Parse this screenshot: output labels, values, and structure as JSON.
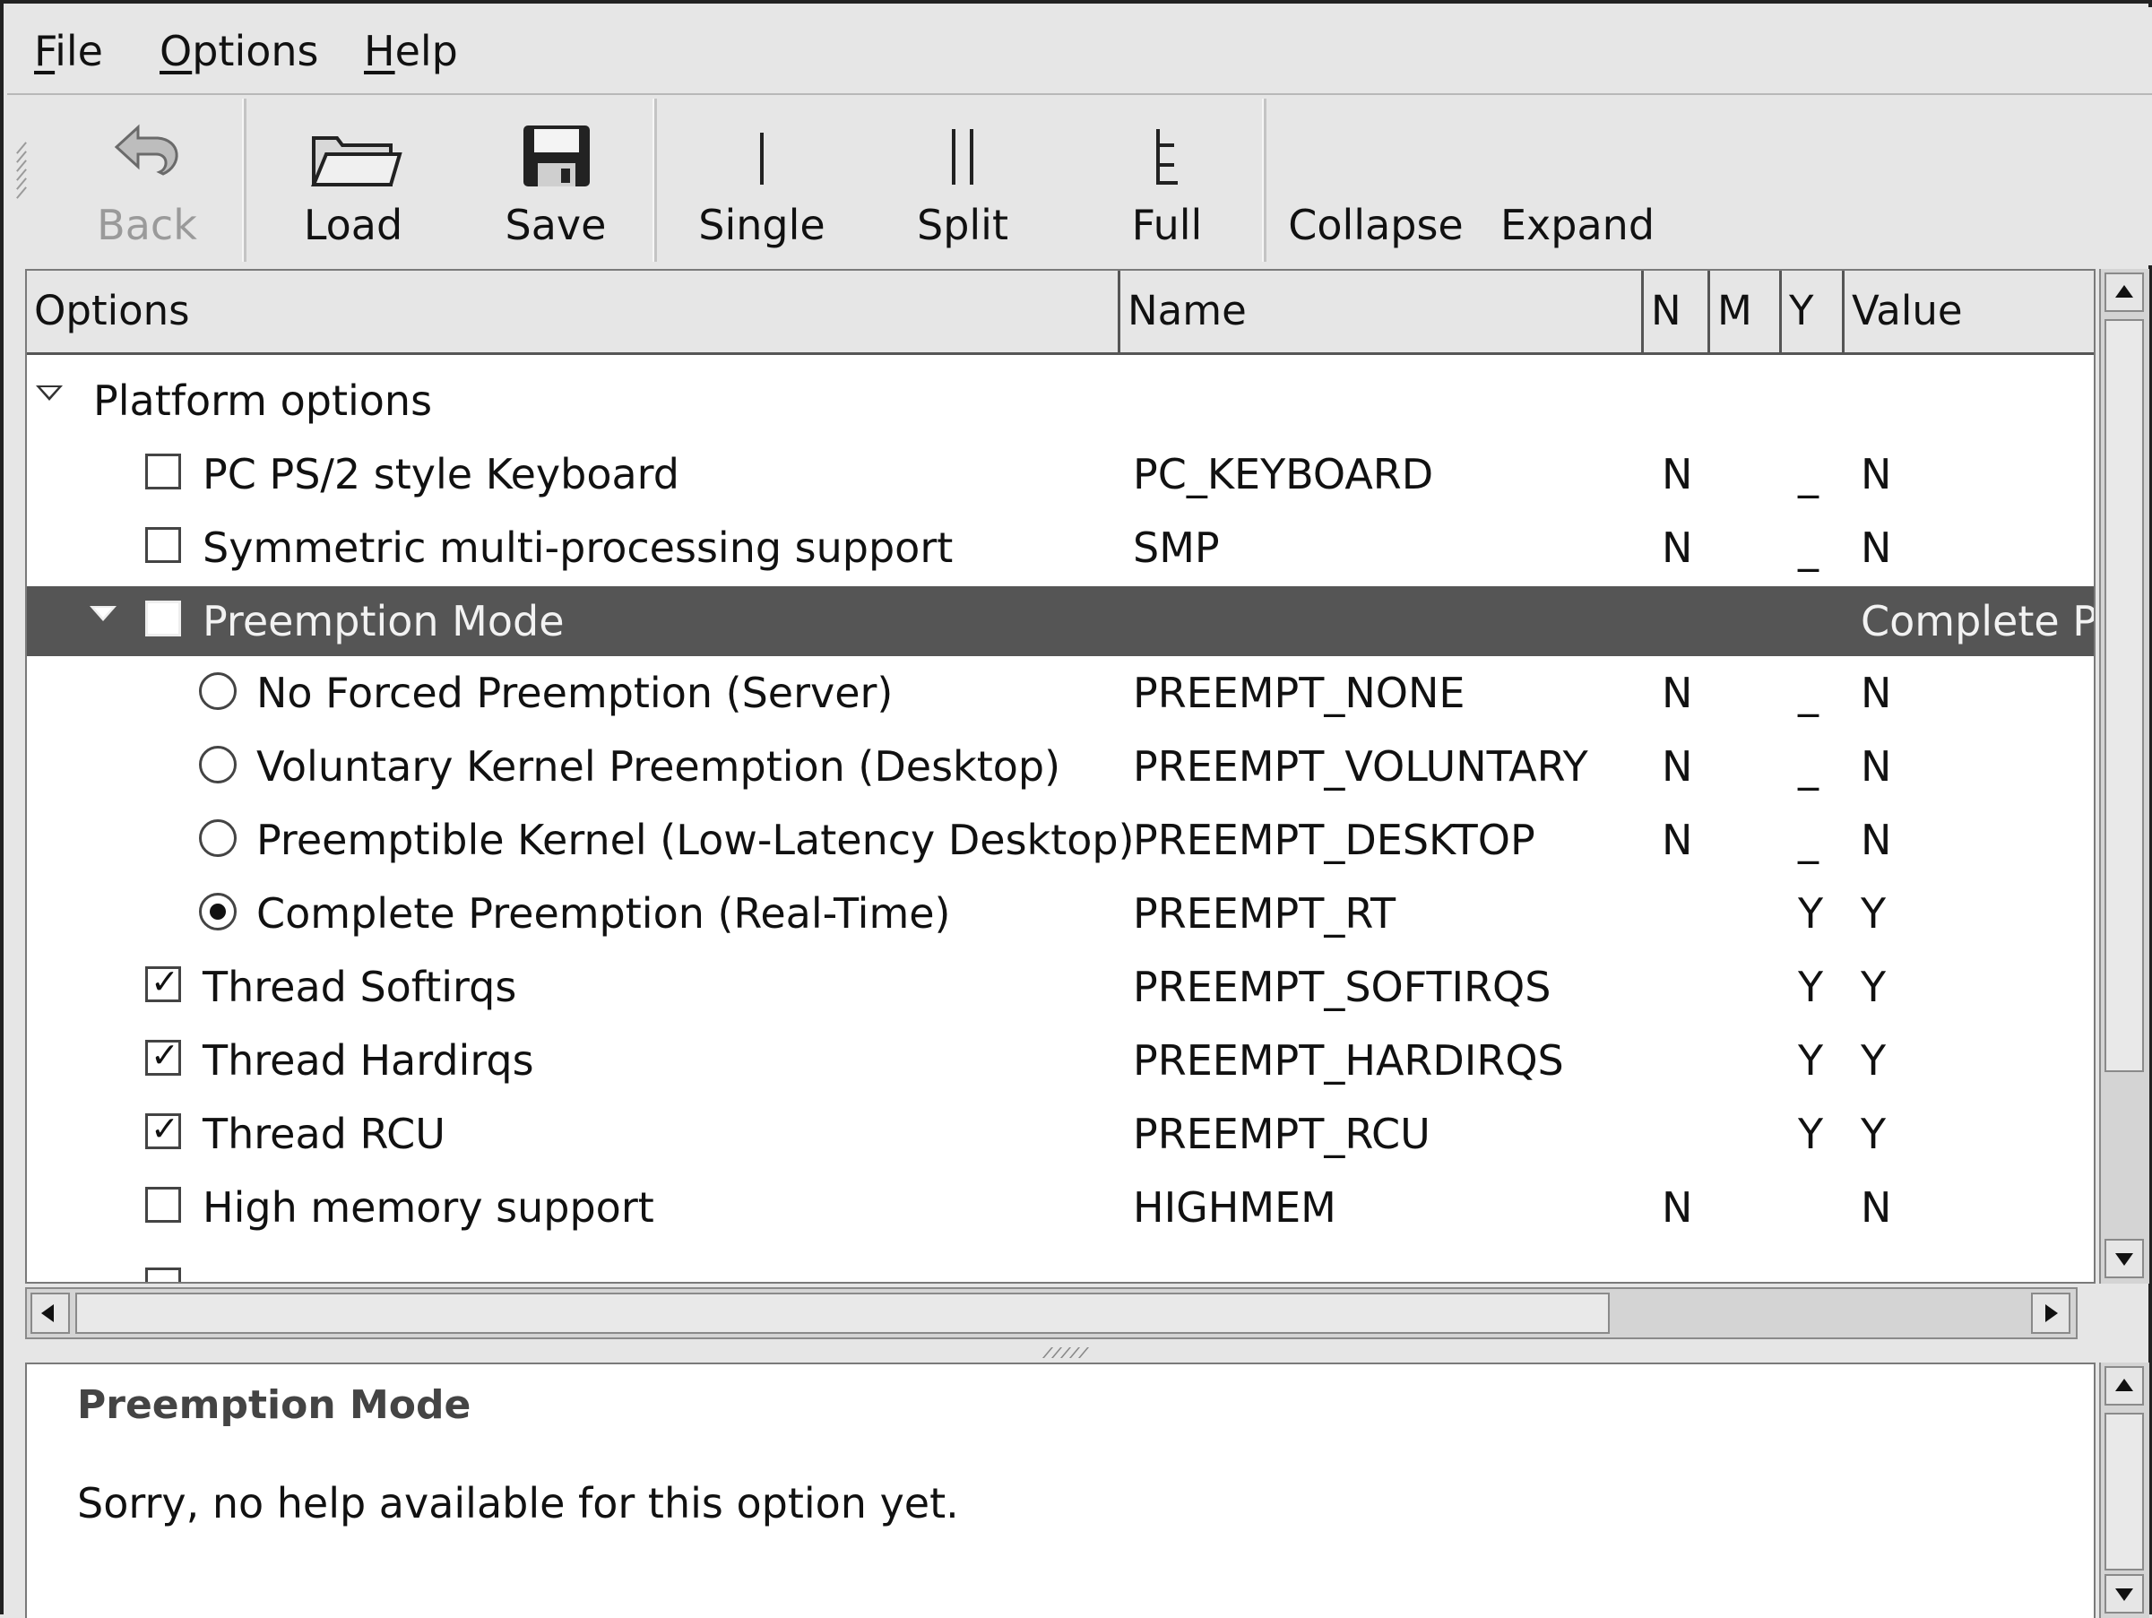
{
  "menu": {
    "file": {
      "mnemonic": "F",
      "rest": "ile"
    },
    "options": {
      "mnemonic": "O",
      "rest": "ptions"
    },
    "help": {
      "mnemonic": "H",
      "rest": "elp"
    }
  },
  "toolbar": {
    "back": {
      "label": "Back",
      "icon": "back-arrow-icon",
      "enabled": false
    },
    "load": {
      "label": "Load",
      "icon": "folder-icon"
    },
    "save": {
      "label": "Save",
      "icon": "floppy-disk-icon"
    },
    "single": {
      "label": "Single",
      "icon": "single-view-icon"
    },
    "split": {
      "label": "Split",
      "icon": "split-view-icon"
    },
    "full": {
      "label": "Full",
      "icon": "full-view-icon"
    },
    "collapse": {
      "label": "Collapse"
    },
    "expand": {
      "label": "Expand"
    }
  },
  "table": {
    "columns": [
      "Options",
      "Name",
      "N",
      "M",
      "Y",
      "Value"
    ],
    "rows": [
      {
        "kind": "section",
        "label": "Platform options",
        "name": "",
        "n": "",
        "m": "",
        "y": "",
        "value": ""
      },
      {
        "kind": "checkbox",
        "checked": false,
        "label": "PC PS/2 style Keyboard",
        "name": "PC_KEYBOARD",
        "n": "N",
        "m": "",
        "y": "_",
        "value": "N"
      },
      {
        "kind": "checkbox",
        "checked": false,
        "label": "Symmetric multi-processing support",
        "name": "SMP",
        "n": "N",
        "m": "",
        "y": "_",
        "value": "N"
      },
      {
        "kind": "choice-group",
        "selected": true,
        "label": "Preemption Mode",
        "name": "",
        "n": "",
        "m": "",
        "y": "",
        "value": "Complete P"
      },
      {
        "kind": "radio",
        "checked": false,
        "label": "No Forced Preemption (Server)",
        "name": "PREEMPT_NONE",
        "n": "N",
        "m": "",
        "y": "_",
        "value": "N"
      },
      {
        "kind": "radio",
        "checked": false,
        "label": "Voluntary Kernel Preemption (Desktop)",
        "name": "PREEMPT_VOLUNTARY",
        "n": "N",
        "m": "",
        "y": "_",
        "value": "N"
      },
      {
        "kind": "radio",
        "checked": false,
        "label": "Preemptible Kernel (Low-Latency Desktop)",
        "name": "PREEMPT_DESKTOP",
        "n": "N",
        "m": "",
        "y": "_",
        "value": "N"
      },
      {
        "kind": "radio",
        "checked": true,
        "label": "Complete Preemption (Real-Time)",
        "name": "PREEMPT_RT",
        "n": "",
        "m": "",
        "y": "Y",
        "value": "Y"
      },
      {
        "kind": "checkbox",
        "checked": true,
        "label": "Thread Softirqs",
        "name": "PREEMPT_SOFTIRQS",
        "n": "",
        "m": "",
        "y": "Y",
        "value": "Y"
      },
      {
        "kind": "checkbox",
        "checked": true,
        "label": "Thread Hardirqs",
        "name": "PREEMPT_HARDIRQS",
        "n": "",
        "m": "",
        "y": "Y",
        "value": "Y"
      },
      {
        "kind": "checkbox",
        "checked": true,
        "label": "Thread RCU",
        "name": "PREEMPT_RCU",
        "n": "",
        "m": "",
        "y": "Y",
        "value": "Y"
      },
      {
        "kind": "checkbox",
        "checked": false,
        "label": "High memory support",
        "name": "HIGHMEM",
        "n": "N",
        "m": "",
        "y": "",
        "value": "N"
      }
    ]
  },
  "help": {
    "title": "Preemption Mode",
    "text": "Sorry, no help available for this option yet."
  }
}
